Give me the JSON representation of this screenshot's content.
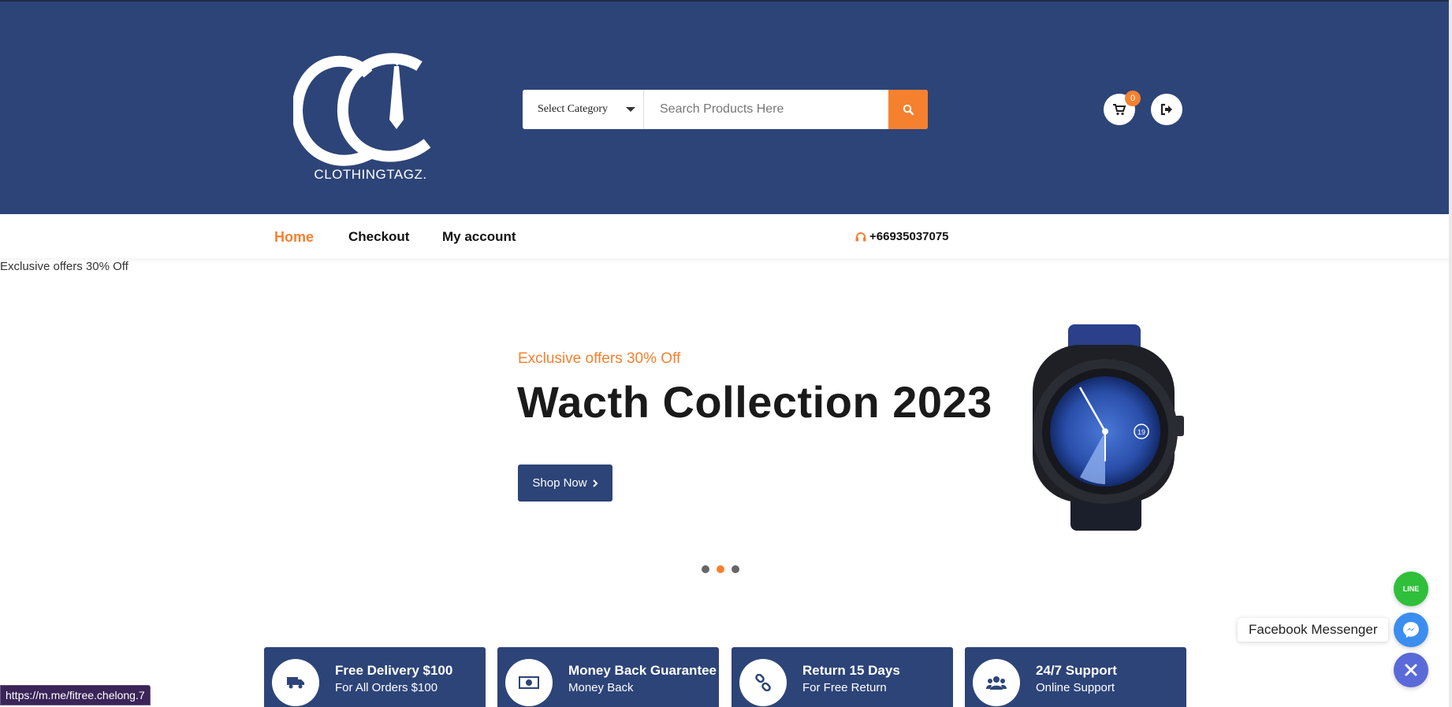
{
  "header": {
    "logo_text": "CLOTHINGTAGZ.",
    "category_select": "Select Category",
    "search_placeholder": "Search Products Here",
    "cart_count": "0"
  },
  "nav": {
    "home": "Home",
    "checkout": "Checkout",
    "my_account": "My account",
    "phone": "+66935037075"
  },
  "hero": {
    "broken_image_alt": "Exclusive offers 30% Off",
    "subtitle": "Exclusive offers 30% Off",
    "title": "Wacth Collection 2023",
    "button": "Shop Now",
    "slides": 3,
    "active_slide": 2,
    "watch_date": "19"
  },
  "features": [
    {
      "title": "Free Delivery $100",
      "subtitle": "For All Orders $100",
      "icon": "truck-icon"
    },
    {
      "title": "Money Back Guarantee",
      "subtitle": "Money Back",
      "icon": "money-icon"
    },
    {
      "title": "Return 15 Days",
      "subtitle": "For Free Return",
      "icon": "link-icon"
    },
    {
      "title": "24/7 Support",
      "subtitle": "Online Support",
      "icon": "users-icon"
    }
  ],
  "status_bar": {
    "url": "https://m.me/fitree.chelong.7"
  },
  "floating": {
    "line_label": "LINE",
    "messenger_label": "Facebook Messenger"
  },
  "colors": {
    "brand_navy": "#2d4478",
    "accent_orange": "#f5812f"
  }
}
